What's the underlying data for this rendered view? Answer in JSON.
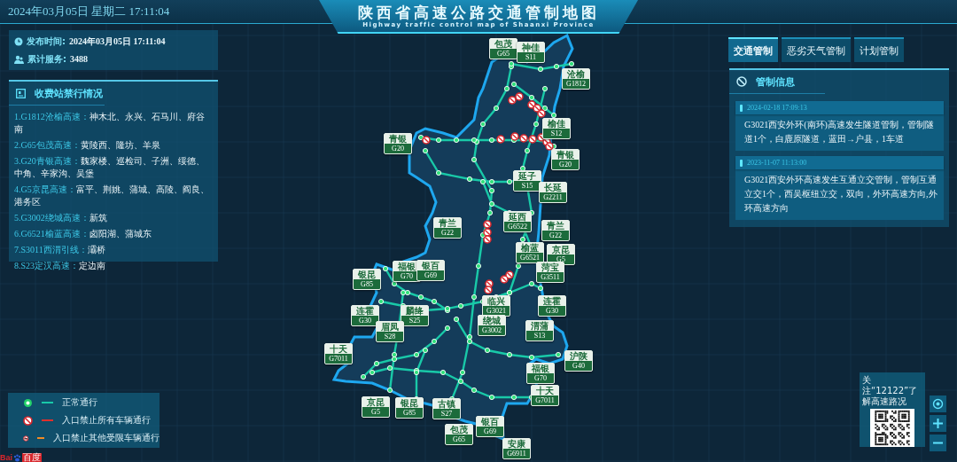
{
  "header": {
    "datetime": "2024年03月05日 星期二  17:11:04",
    "title": "陕西省高速公路交通管制地图",
    "subtitle": "Highway traffic control map of Shaanxi Province"
  },
  "info": [
    {
      "kind": "clock",
      "label": "发布时间:",
      "value": "2024年03月05日  17:11:04"
    },
    {
      "kind": "users",
      "label": "累计服务:",
      "value": "3488"
    }
  ],
  "toll_panel": {
    "title": "收费站禁行情况",
    "items": [
      {
        "road": "1.G1812沧榆高速：",
        "stations": "神木北、永兴、石马川、府谷南"
      },
      {
        "road": "2.G65包茂高速：",
        "stations": "黄陵西、隆坊、羊泉"
      },
      {
        "road": "3.G20青银高速：",
        "stations": "魏家楼、巡检司、子洲、绥德、中角、辛家沟、吴堡"
      },
      {
        "road": "4.G5京昆高速：",
        "stations": "富平、荆姚、蒲城、高陵、阎良、港务区"
      },
      {
        "road": "5.G3002绕城高速：",
        "stations": "新筑"
      },
      {
        "road": "6.G6521榆蓝高速：",
        "stations": "卤阳湖、蒲城东"
      },
      {
        "road": "7.S3011西渭引线：",
        "stations": "灞桥"
      },
      {
        "road": "8.S23定汉高速：",
        "stations": "定边南"
      }
    ]
  },
  "tabs": [
    {
      "label": "交通管制",
      "selected": true
    },
    {
      "label": "恶劣天气管制",
      "selected": false
    },
    {
      "label": "计划管制",
      "selected": false
    }
  ],
  "control_panel": {
    "title": "管制信息",
    "notices": [
      {
        "time": "2024-02-18 17:09:13",
        "text": "G3021西安外环(南环)高速发生隧道管制，管制隧道1个，白鹿原隧道，蓝田→户县，1车道"
      },
      {
        "time": "2023-11-07 11:13:00",
        "text": "G3021西安外环高速发生互通立交管制，管制互通立交1个，西吴枢纽立交，双向，外环高速方向,外环高速方向"
      }
    ]
  },
  "signs": [
    {
      "name": "包茂",
      "code": "G65"
    },
    {
      "name": "神佳",
      "code": "S11"
    },
    {
      "name": "沧榆",
      "code": "G1812"
    },
    {
      "name": "青银",
      "code": "G20"
    },
    {
      "name": "榆佳",
      "code": "S12"
    },
    {
      "name": "青银",
      "code": "G20"
    },
    {
      "name": "延子",
      "code": "S15"
    },
    {
      "name": "长延",
      "code": "G2211"
    },
    {
      "name": "青兰",
      "code": "G22"
    },
    {
      "name": "延西",
      "code": "G6522"
    },
    {
      "name": "青兰",
      "code": "G22"
    },
    {
      "name": "榆蓝",
      "code": "G6521"
    },
    {
      "name": "京昆",
      "code": "G5"
    },
    {
      "name": "菏宝",
      "code": "G3511"
    },
    {
      "name": "银昆",
      "code": "G85"
    },
    {
      "name": "福银",
      "code": "G70"
    },
    {
      "name": "银百",
      "code": "G69"
    },
    {
      "name": "连霍",
      "code": "G30"
    },
    {
      "name": "临兴",
      "code": "G3021"
    },
    {
      "name": "连霍",
      "code": "G30"
    },
    {
      "name": "麟绛",
      "code": "S25"
    },
    {
      "name": "绕城",
      "code": "G3002"
    },
    {
      "name": "渭蒲",
      "code": "S13"
    },
    {
      "name": "眉凤",
      "code": "S28"
    },
    {
      "name": "十天",
      "code": "G7011"
    },
    {
      "name": "沪陕",
      "code": "G40"
    },
    {
      "name": "福银",
      "code": "G70"
    },
    {
      "name": "十天",
      "code": "G7011"
    },
    {
      "name": "京昆",
      "code": "G5"
    },
    {
      "name": "银昆",
      "code": "G85"
    },
    {
      "name": "古镇",
      "code": "S27"
    },
    {
      "name": "包茂",
      "code": "G65"
    },
    {
      "name": "银百",
      "code": "G69"
    },
    {
      "name": "安康",
      "code": "G6911"
    }
  ],
  "legend": [
    {
      "kind": "normal",
      "label": "正常通行",
      "color": "#19c9a8"
    },
    {
      "kind": "closed-all",
      "label": "入口禁止所有车辆通行",
      "color": "#e0302c"
    },
    {
      "kind": "closed-other",
      "label": "入口禁止其他受限车辆通行",
      "color": "#f08a24"
    }
  ],
  "qr": {
    "caption": "关注“12122”了解高速路况"
  },
  "logo": {
    "latin": "Bai",
    "chinese": "百度"
  }
}
